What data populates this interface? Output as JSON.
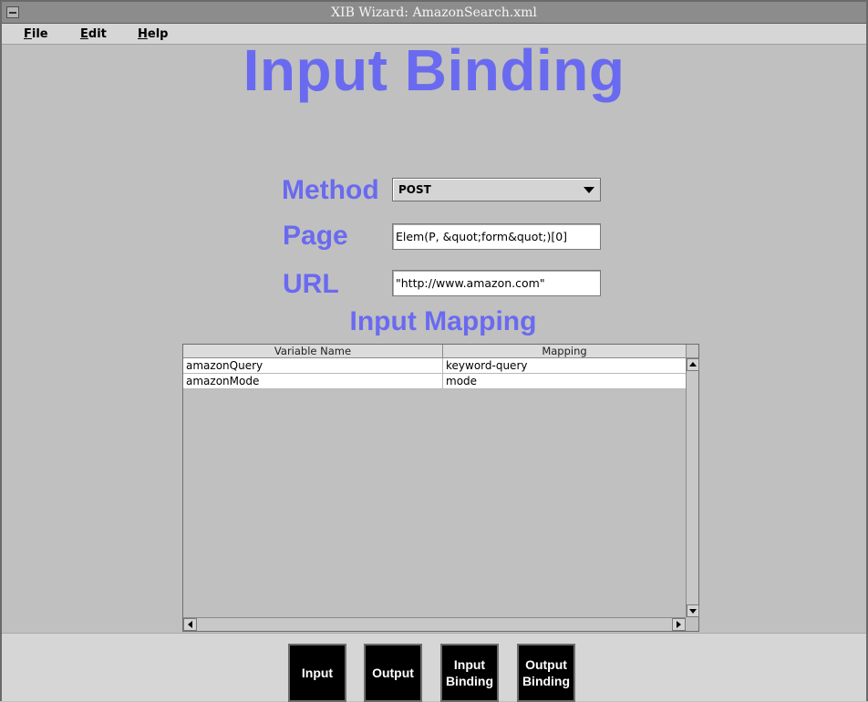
{
  "window": {
    "title": "XIB Wizard: AmazonSearch.xml"
  },
  "menubar": {
    "items": [
      {
        "mnemonic": "F",
        "rest": "ile"
      },
      {
        "mnemonic": "E",
        "rest": "dit"
      },
      {
        "mnemonic": "H",
        "rest": "elp"
      }
    ]
  },
  "main": {
    "heading": "Input Binding",
    "method": {
      "label": "Method",
      "value": "POST"
    },
    "page": {
      "label": "Page",
      "value": "Elem(P, &quot;form&quot;)[0]"
    },
    "url": {
      "label": "URL",
      "value": "\"http://www.amazon.com\""
    },
    "mapping_heading": "Input Mapping",
    "table": {
      "columns": [
        "Variable Name",
        "Mapping"
      ],
      "rows": [
        [
          "amazonQuery",
          "keyword-query"
        ],
        [
          "amazonMode",
          "mode"
        ]
      ]
    }
  },
  "nav": {
    "buttons": [
      {
        "line1": "Input",
        "line2": ""
      },
      {
        "line1": "Output",
        "line2": ""
      },
      {
        "line1": "Input",
        "line2": "Binding"
      },
      {
        "line1": "Output",
        "line2": "Binding"
      }
    ]
  },
  "colors": {
    "accent": "#6a6af0",
    "window_bg": "#c0c0c0",
    "nav_button_bg": "#000000"
  }
}
